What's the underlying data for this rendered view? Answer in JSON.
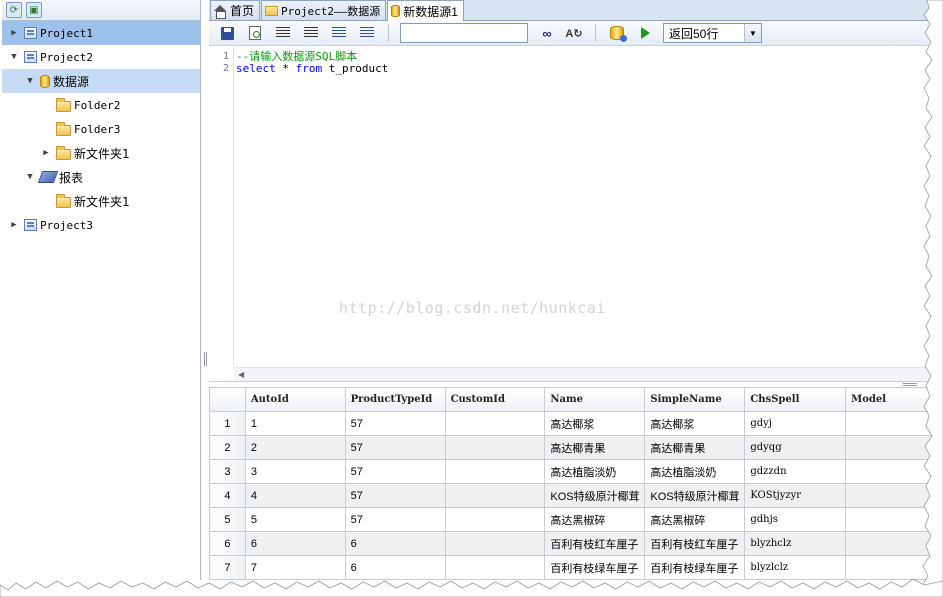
{
  "left_toolbar": {
    "icons": [
      "refresh-icon",
      "project-add-icon"
    ]
  },
  "tree": [
    {
      "label": "Project1",
      "icon": "project-icon",
      "level": 0,
      "arrow": "▶",
      "state": "selected"
    },
    {
      "label": "Project2",
      "icon": "project-icon",
      "level": 0,
      "arrow": "▼",
      "state": ""
    },
    {
      "label": "数据源",
      "icon": "database-icon",
      "level": 1,
      "arrow": "▼",
      "state": "selected-light"
    },
    {
      "label": "Folder2",
      "icon": "folder-icon",
      "level": 2,
      "arrow": "",
      "state": ""
    },
    {
      "label": "Folder3",
      "icon": "folder-icon",
      "level": 2,
      "arrow": "",
      "state": ""
    },
    {
      "label": "新文件夹1",
      "icon": "folder-icon",
      "level": 2,
      "arrow": "▶",
      "state": ""
    },
    {
      "label": "报表",
      "icon": "report-icon",
      "level": 1,
      "arrow": "▼",
      "state": ""
    },
    {
      "label": "新文件夹1",
      "icon": "folder-icon",
      "level": 2,
      "arrow": "",
      "state": ""
    },
    {
      "label": "Project3",
      "icon": "project-icon",
      "level": 0,
      "arrow": "▶",
      "state": ""
    }
  ],
  "tabs": [
    {
      "label": "首页",
      "icon": "home-icon"
    },
    {
      "label": "Project2——数据源",
      "icon": "folder-icon"
    },
    {
      "label": "新数据源1",
      "icon": "database-icon",
      "active": true
    }
  ],
  "toolbar": {
    "search_value": "",
    "rows_select": "返回50行"
  },
  "editor": {
    "line_numbers": [
      "1",
      "2"
    ],
    "line1_comment": "--请输入数据源SQL脚本",
    "line2_kw1": "select",
    "line2_mid": " * ",
    "line2_kw2": "from",
    "line2_rest": " t_product"
  },
  "watermark": "http://blog.csdn.net/hunkcai",
  "grid": {
    "columns": [
      "",
      "AutoId",
      "ProductTypeId",
      "CustomId",
      "Name",
      "SimpleName",
      "ChsSpell",
      "Model"
    ],
    "rows": [
      [
        "1",
        "1",
        "57",
        "",
        "高达椰浆",
        "高达椰浆",
        "gdyj",
        ""
      ],
      [
        "2",
        "2",
        "57",
        "",
        "高达椰青果",
        "高达椰青果",
        "gdyqg",
        ""
      ],
      [
        "3",
        "3",
        "57",
        "",
        "高达植脂淡奶",
        "高达植脂淡奶",
        "gdzzdn",
        ""
      ],
      [
        "4",
        "4",
        "57",
        "",
        "KOS特级原汁椰茸",
        "KOS特级原汁椰茸",
        "KOStjyzyr",
        ""
      ],
      [
        "5",
        "5",
        "57",
        "",
        "高达黑椒碎",
        "高达黑椒碎",
        "gdhjs",
        ""
      ],
      [
        "6",
        "6",
        "6",
        "",
        "百利有枝红车厘子",
        "百利有枝红车厘子",
        "blyzhclz",
        ""
      ],
      [
        "7",
        "7",
        "6",
        "",
        "百利有枝绿车厘子",
        "百利有枝绿车厘子",
        "blyzlclz",
        ""
      ]
    ]
  }
}
